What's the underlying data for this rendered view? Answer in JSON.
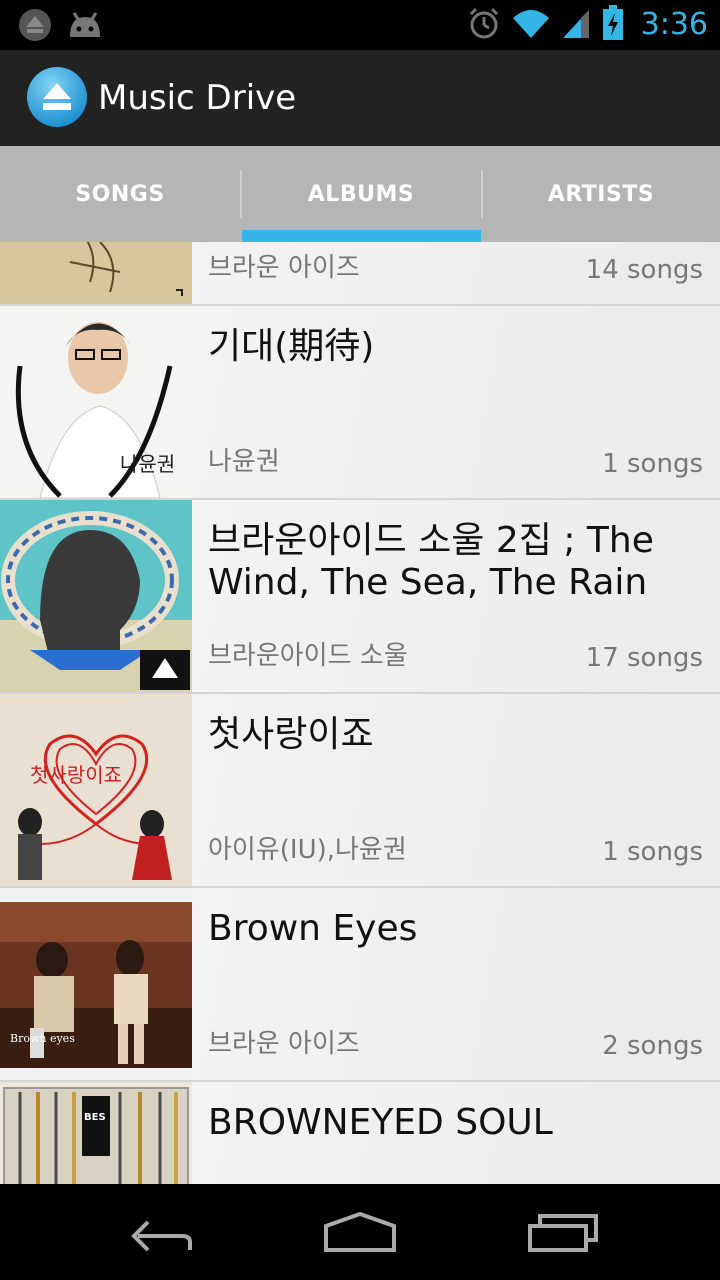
{
  "status_bar": {
    "time": "3:36",
    "icons": [
      "notification-icon",
      "android-icon",
      "alarm-icon",
      "wifi-icon",
      "signal-icon",
      "battery-charging-icon"
    ]
  },
  "action_bar": {
    "title": "Music Drive",
    "logo_icon": "eject-logo-icon"
  },
  "tabs": [
    {
      "label": "SONGS",
      "selected": false
    },
    {
      "label": "ALBUMS",
      "selected": true
    },
    {
      "label": "ARTISTS",
      "selected": false
    }
  ],
  "accent_color": "#33b5e5",
  "albums": [
    {
      "title": "",
      "artist": "브라운 아이즈",
      "count": "14 songs"
    },
    {
      "title": "기대(期待)",
      "artist": "나윤권",
      "count": "1 songs"
    },
    {
      "title": "브라운아이드 소울 2집 ; The Wind, The Sea, The Rain",
      "artist": "브라운아이드 소울",
      "count": "17 songs"
    },
    {
      "title": "첫사랑이죠",
      "artist": "아이유(IU),나윤권",
      "count": "1 songs"
    },
    {
      "title": "Brown Eyes",
      "artist": "브라운 아이즈",
      "count": "2 songs"
    },
    {
      "title": "BROWNEYED SOUL",
      "artist": "",
      "count": ""
    }
  ],
  "nav_bar": {
    "icons": [
      "back-icon",
      "home-icon",
      "recent-apps-icon"
    ]
  }
}
